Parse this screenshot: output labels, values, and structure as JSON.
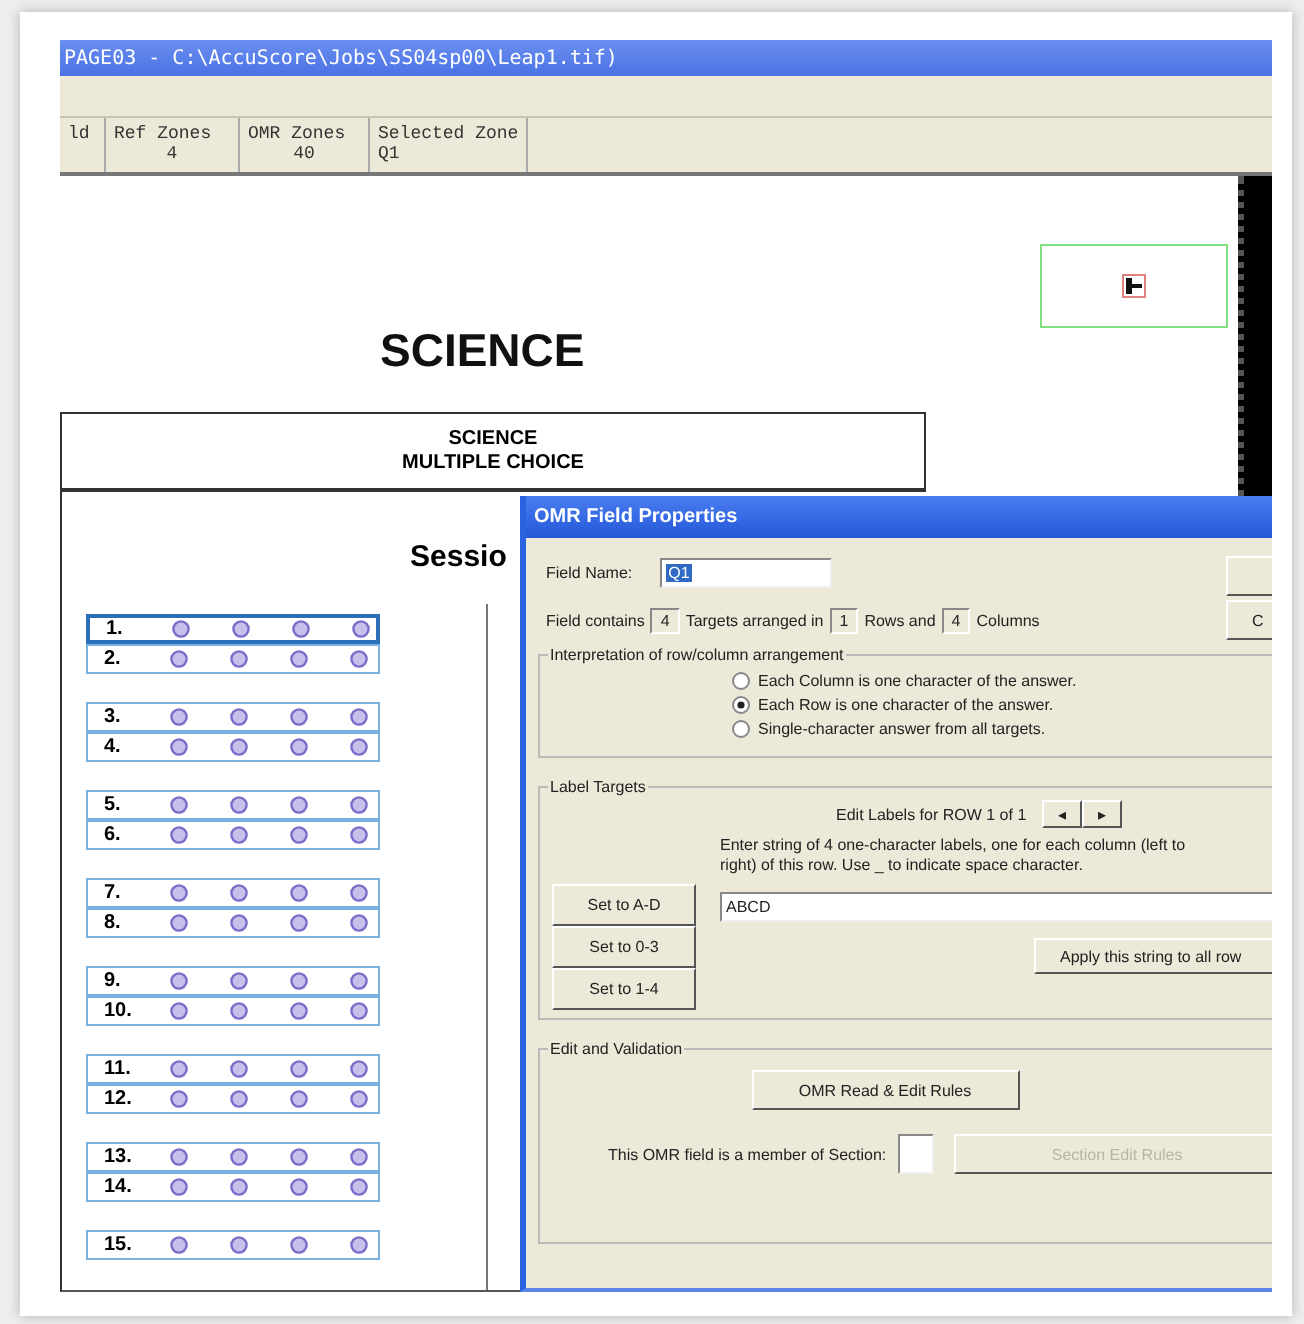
{
  "window": {
    "title": "PAGE03 - C:\\AccuScore\\Jobs\\SS04sp00\\Leap1.tif)"
  },
  "status_cells": [
    {
      "label": "ld"
    },
    {
      "label": "Ref Zones",
      "value": "4"
    },
    {
      "label": "OMR Zones",
      "value": "40"
    },
    {
      "label": "Selected Zone",
      "value": "Q1"
    }
  ],
  "document": {
    "heading": "SCIENCE",
    "box_lines": [
      "SCIENCE",
      "MULTIPLE CHOICE"
    ],
    "session": "Sessio",
    "question_groups": [
      {
        "questions": [
          {
            "number": "1.",
            "selected": true
          },
          {
            "number": "2.",
            "selected": false
          }
        ]
      },
      {
        "questions": [
          {
            "number": "3.",
            "selected": false
          },
          {
            "number": "4.",
            "selected": false
          }
        ]
      },
      {
        "questions": [
          {
            "number": "5.",
            "selected": false
          },
          {
            "number": "6.",
            "selected": false
          }
        ]
      },
      {
        "questions": [
          {
            "number": "7.",
            "selected": false
          },
          {
            "number": "8.",
            "selected": false
          }
        ]
      },
      {
        "questions": [
          {
            "number": "9.",
            "selected": false
          },
          {
            "number": "10.",
            "selected": false
          }
        ]
      },
      {
        "questions": [
          {
            "number": "11.",
            "selected": false
          },
          {
            "number": "12.",
            "selected": false
          }
        ]
      },
      {
        "questions": [
          {
            "number": "13.",
            "selected": false
          },
          {
            "number": "14.",
            "selected": false
          }
        ]
      },
      {
        "questions": [
          {
            "number": "15.",
            "selected": false
          }
        ]
      }
    ]
  },
  "dialog": {
    "title": "OMR Field Properties",
    "field_name_label": "Field Name:",
    "field_name_value": "Q1",
    "side_buttons": [
      "C"
    ],
    "contains": {
      "prefix": "Field contains",
      "targets": "4",
      "mid1": "Targets arranged in",
      "rows": "1",
      "mid2": "Rows and",
      "columns": "4",
      "suffix": "Columns"
    },
    "interpretation": {
      "title": "Interpretation of row/column arrangement",
      "options": [
        {
          "label": "Each Column is one character of the answer.",
          "selected": false
        },
        {
          "label": "Each Row is one character of the answer.",
          "selected": true
        },
        {
          "label": "Single-character answer from all targets.",
          "selected": false
        }
      ]
    },
    "label_targets": {
      "title": "Label Targets",
      "row_label": "Edit Labels for ROW 1 of 1",
      "prev": "◂",
      "next": "▸",
      "instruction": [
        "Enter string of 4 one-character labels, one for each column (left to",
        "right) of this row.  Use _ to indicate space character."
      ],
      "set_buttons": [
        "Set to A-D",
        "Set to 0-3",
        "Set to 1-4"
      ],
      "value": "ABCD",
      "apply_button": "Apply this string to all row"
    },
    "validation": {
      "title": "Edit and Validation",
      "rules_button": "OMR Read & Edit Rules",
      "section_label": "This OMR field is a member of Section:",
      "section_button": {
        "label": "Section Edit Rules",
        "disabled": true
      }
    }
  }
}
